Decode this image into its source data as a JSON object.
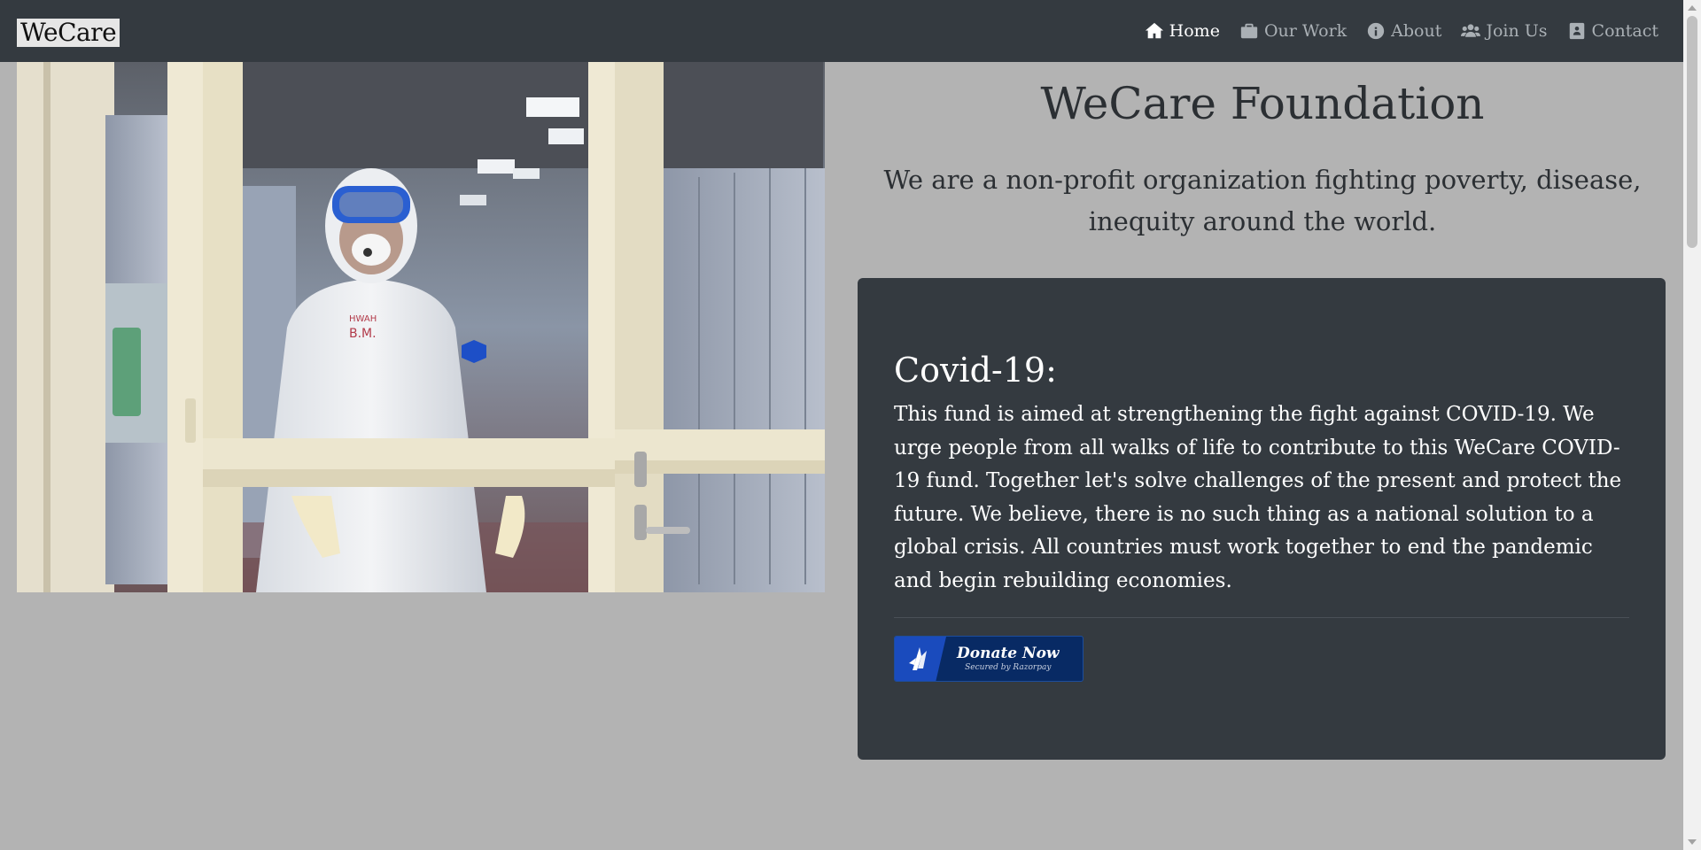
{
  "navbar": {
    "brand": "WeCare",
    "links": [
      {
        "label": "Home",
        "icon": "home-icon",
        "active": true
      },
      {
        "label": "Our Work",
        "icon": "briefcase-icon",
        "active": false
      },
      {
        "label": "About",
        "icon": "info-circle-icon",
        "active": false
      },
      {
        "label": "Join Us",
        "icon": "users-icon",
        "active": false
      },
      {
        "label": "Contact",
        "icon": "address-book-icon",
        "active": false
      }
    ]
  },
  "hero": {
    "title": "WeCare Foundation",
    "tagline": "We are a non-profit organization fighting poverty, disease, inequity around the world."
  },
  "card": {
    "title": "Covid-19:",
    "text": "This fund is aimed at strengthening the fight against COVID-19. We urge people from all walks of life to contribute to this WeCare COVID-19 fund. Together let's solve challenges of the present and protect the future. We believe, there is no such thing as a national solution to a global crisis. All countries must work together to end the pandemic and begin rebuilding economies.",
    "donate_label": "Donate Now",
    "donate_sub": "Secured by Razorpay"
  },
  "colors": {
    "navbar_bg": "#343a40",
    "page_bg": "#b3b3b3",
    "card_bg": "#343a40",
    "donate_bg": "#082a64",
    "donate_accent": "#1a4bbd"
  }
}
